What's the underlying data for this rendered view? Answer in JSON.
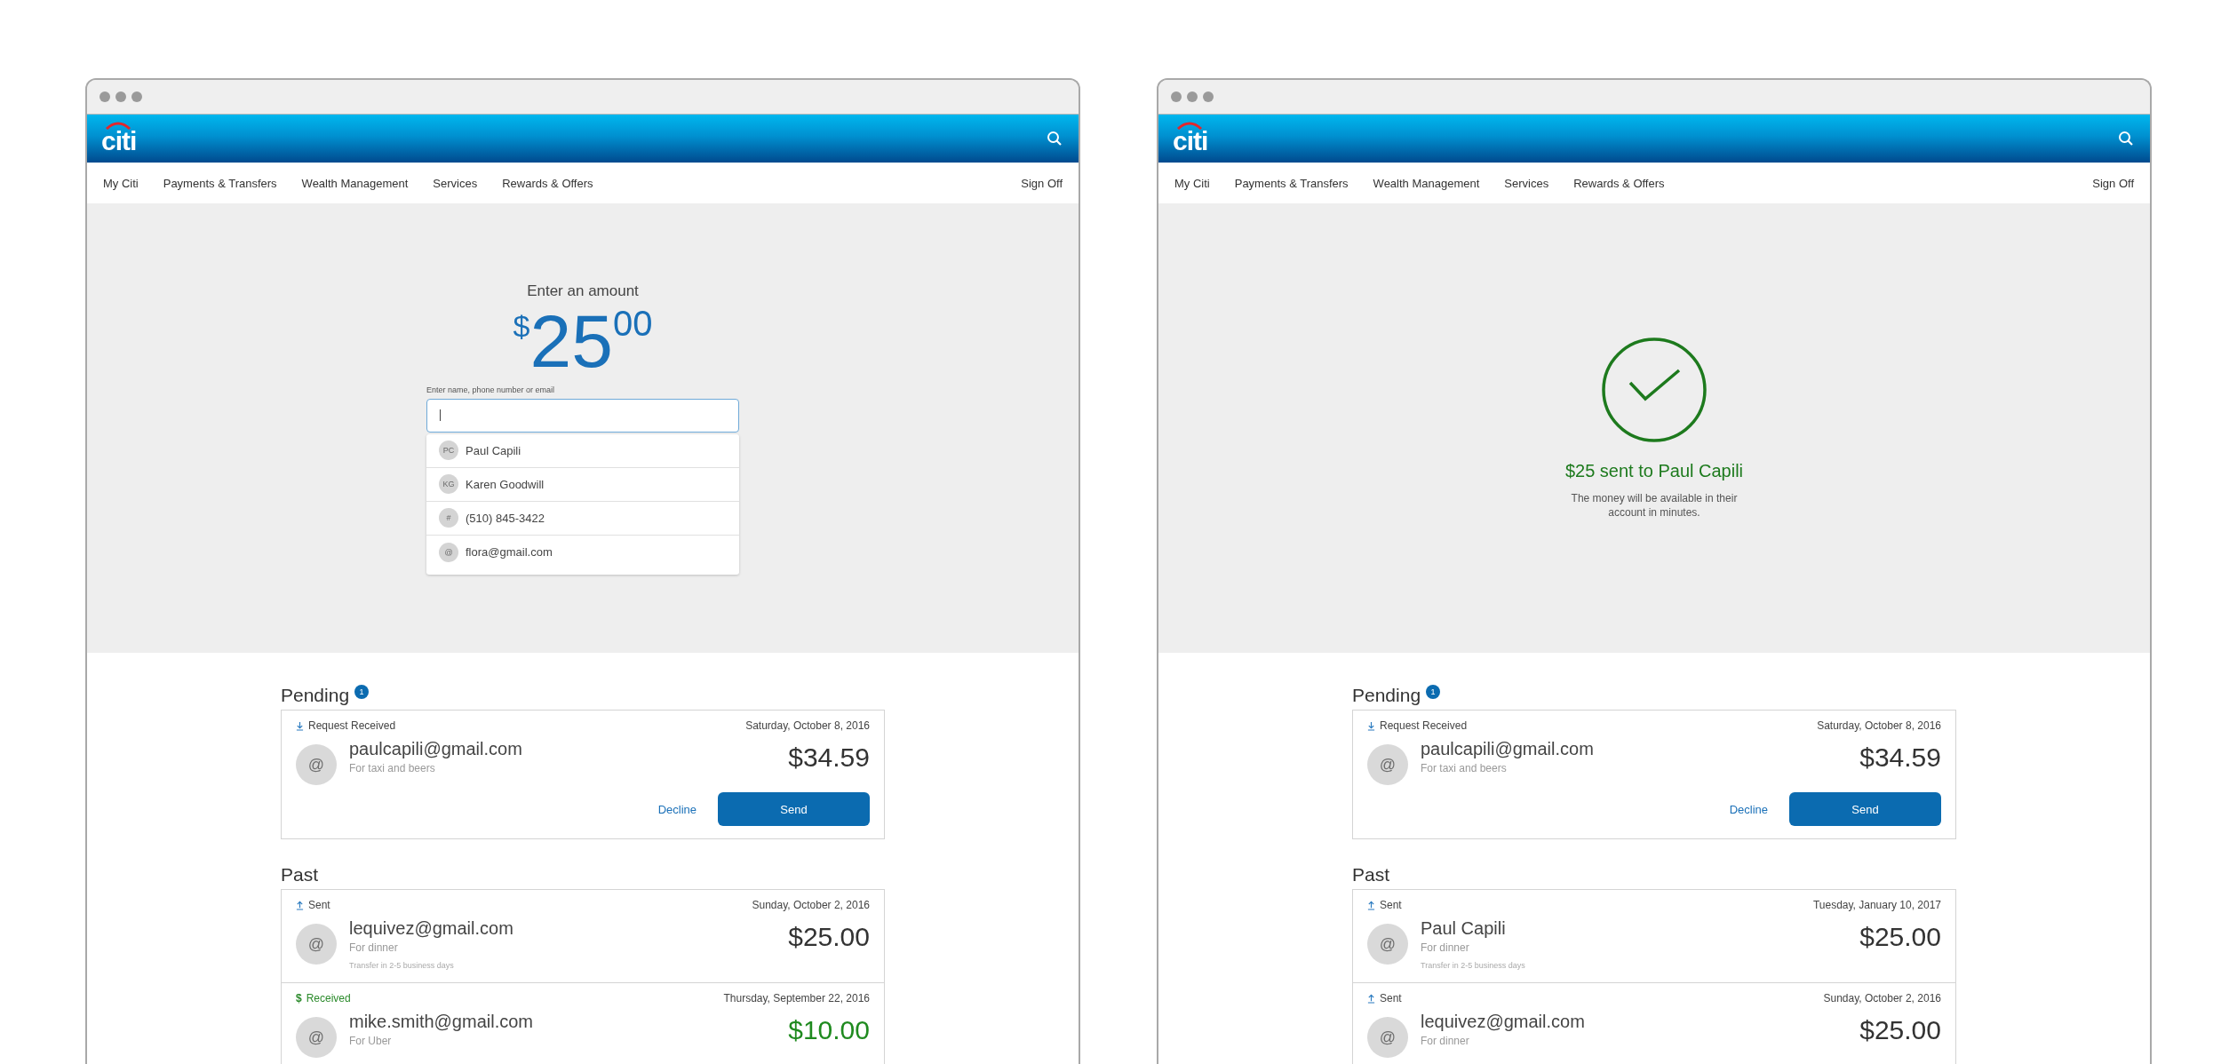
{
  "windows": [
    {
      "header": {
        "logo": "citi",
        "nav": [
          "My Citi",
          "Payments & Transfers",
          "Wealth Management",
          "Services",
          "Rewards & Offers"
        ],
        "sign_off": "Sign Off"
      },
      "hero": {
        "kind": "amount_entry",
        "prompt": "Enter an amount",
        "currency": "$",
        "whole": "25",
        "cents": "00",
        "field": {
          "label": "Enter name, phone number or email",
          "focused": true
        },
        "suggestions": [
          {
            "initials": "PC",
            "label": "Paul Capili"
          },
          {
            "initials": "KG",
            "label": "Karen Goodwill"
          },
          {
            "initials": "#",
            "label": "(510) 845-3422"
          },
          {
            "initials": "@",
            "label": "flora@gmail.com"
          }
        ]
      },
      "pending": {
        "title": "Pending",
        "badge": "1",
        "items": [
          {
            "kind": "request",
            "type_label": "Request Received",
            "date": "Saturday, October 8, 2016",
            "avatar": "@",
            "name": "paulcapili@gmail.com",
            "memo": "For taxi and beers",
            "amount": "$34.59",
            "decline": "Decline",
            "send": "Send"
          }
        ]
      },
      "past": {
        "title": "Past",
        "items": [
          {
            "kind": "sent",
            "type_label": "Sent",
            "date": "Sunday, October 2, 2016",
            "avatar": "@",
            "name": "lequivez@gmail.com",
            "memo": "For dinner",
            "note": "Transfer in 2-5 business days",
            "amount": "$25.00"
          },
          {
            "kind": "received",
            "glyph": "$",
            "type_label": "Received",
            "date": "Thursday, September 22, 2016",
            "avatar": "@",
            "name": "mike.smith@gmail.com",
            "memo": "For Uber",
            "amount": "$10.00"
          }
        ]
      }
    },
    {
      "header": {
        "logo": "citi",
        "nav": [
          "My Citi",
          "Payments & Transfers",
          "Wealth Management",
          "Services",
          "Rewards & Offers"
        ],
        "sign_off": "Sign Off"
      },
      "hero": {
        "kind": "confirmation",
        "message": "$25 sent to Paul Capili",
        "note": "The money will be available in their account in minutes."
      },
      "pending": {
        "title": "Pending",
        "badge": "1",
        "items": [
          {
            "kind": "request",
            "type_label": "Request Received",
            "date": "Saturday, October 8, 2016",
            "avatar": "@",
            "name": "paulcapili@gmail.com",
            "memo": "For taxi and beers",
            "amount": "$34.59",
            "decline": "Decline",
            "send": "Send"
          }
        ]
      },
      "past": {
        "title": "Past",
        "items": [
          {
            "kind": "sent",
            "type_label": "Sent",
            "date": "Tuesday, January 10, 2017",
            "avatar": "@",
            "name": "Paul Capili",
            "memo": "For dinner",
            "note": "Transfer in 2-5 business days",
            "amount": "$25.00"
          },
          {
            "kind": "sent",
            "type_label": "Sent",
            "date": "Sunday, October 2, 2016",
            "avatar": "@",
            "name": "lequivez@gmail.com",
            "memo": "For dinner",
            "amount": "$25.00"
          }
        ]
      }
    }
  ]
}
